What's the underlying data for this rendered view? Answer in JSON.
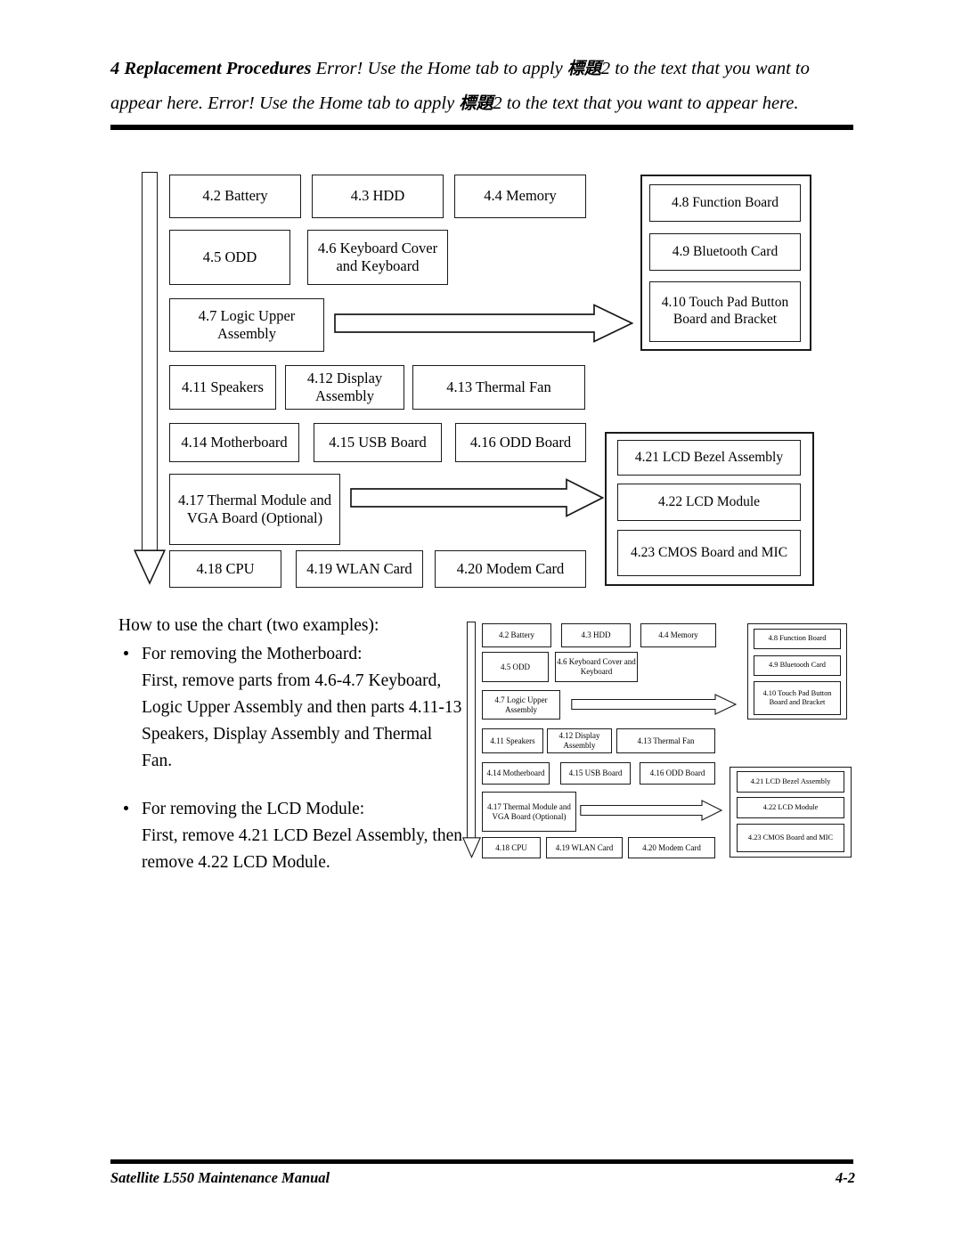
{
  "header": {
    "section_number": "4",
    "section_title": "Replacement Procedures",
    "line1_rest": "Error! Use the Home tab to apply",
    "cjk1": "標題",
    "line1_tail": "2 to the text that you want to",
    "line2_start": "appear here. Error! Use the Home tab to apply",
    "cjk2": "標題",
    "line2_tail": "2 to the text that you want to appear here."
  },
  "diagram": {
    "title": "Replacement procedure flow chart",
    "nodes": [
      {
        "id": "n42",
        "label": "4.2 Battery"
      },
      {
        "id": "n43",
        "label": "4.3 HDD"
      },
      {
        "id": "n44",
        "label": "4.4 Memory"
      },
      {
        "id": "n45",
        "label": "4.5 ODD"
      },
      {
        "id": "n46",
        "label": "4.6 Keyboard Cover and Keyboard"
      },
      {
        "id": "n47",
        "label": "4.7 Logic Upper Assembly"
      },
      {
        "id": "n48",
        "label": "4.8 Function Board"
      },
      {
        "id": "n49",
        "label": "4.9 Bluetooth Card"
      },
      {
        "id": "n410",
        "label": "4.10 Touch Pad Button Board and Bracket"
      },
      {
        "id": "n411",
        "label": "4.11 Speakers"
      },
      {
        "id": "n412",
        "label": "4.12 Display Assembly"
      },
      {
        "id": "n413",
        "label": "4.13 Thermal Fan"
      },
      {
        "id": "n414",
        "label": "4.14 Motherboard"
      },
      {
        "id": "n415",
        "label": "4.15 USB Board"
      },
      {
        "id": "n416",
        "label": "4.16 ODD Board"
      },
      {
        "id": "n417",
        "label": "4.17 Thermal Module and VGA Board (Optional)"
      },
      {
        "id": "n418",
        "label": "4.18 CPU"
      },
      {
        "id": "n419",
        "label": "4.19 WLAN Card"
      },
      {
        "id": "n420",
        "label": "4.20 Modem Card"
      },
      {
        "id": "n421",
        "label": "4.21 LCD Bezel Assembly"
      },
      {
        "id": "n422",
        "label": "4.22 LCD Module"
      },
      {
        "id": "n423",
        "label": "4.23 CMOS Board and MIC"
      }
    ]
  },
  "howto": {
    "lead": "How to use the chart (two examples):",
    "bullet1_title": "For removing the Motherboard:",
    "bullet1_body": "First, remove parts from 4.6-4.7 Keyboard, Logic Upper Assembly and then parts 4.11-13 Speakers, Display Assembly and Thermal Fan.",
    "bullet2_title": "For removing the LCD Module:",
    "bullet2_body": "First, remove 4.21 LCD Bezel Assembly, then remove 4.22 LCD Module."
  },
  "footer": {
    "manual_title": "Satellite L550 Maintenance Manual",
    "page_number": "4-2"
  }
}
